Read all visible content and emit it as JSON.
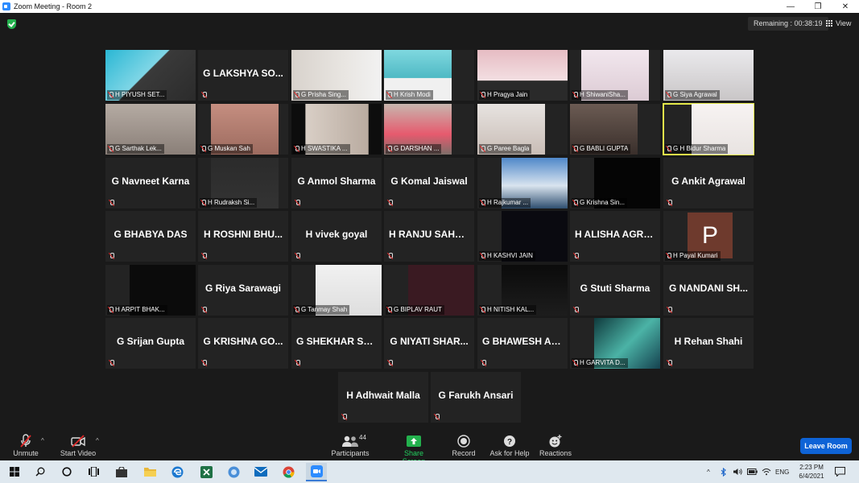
{
  "window": {
    "title": "Zoom Meeting - Room 2",
    "controls": [
      "—",
      "❐",
      "✕"
    ]
  },
  "header": {
    "remaining": "Remaining : 00:38:19",
    "view_label": "View"
  },
  "participants": [
    {
      "name": "H PIYUSH SET...",
      "video": true
    },
    {
      "name": "G LAKSHYA SO...",
      "video": false
    },
    {
      "name": "G Prisha Sing...",
      "video": true
    },
    {
      "name": "H Krish Modi",
      "video": true
    },
    {
      "name": "H Pragya Jain",
      "video": true
    },
    {
      "name": "H ShiwaniSha...",
      "video": true
    },
    {
      "name": "G Siya Agrawal",
      "video": true
    },
    {
      "name": "G Sarthak Lek...",
      "video": true
    },
    {
      "name": "G Muskan Sah",
      "video": true
    },
    {
      "name": "H SWASTIKA ...",
      "video": true
    },
    {
      "name": "G DARSHAN ...",
      "video": true
    },
    {
      "name": "G Paree Bagla",
      "video": true
    },
    {
      "name": "G BABLI GUPTA",
      "video": true
    },
    {
      "name": "G H Bidur Sharma",
      "video": true,
      "speaking": true
    },
    {
      "name": "G Navneet Karna",
      "video": false
    },
    {
      "name": "H Rudraksh Si...",
      "video": true
    },
    {
      "name": "G Anmol Sharma",
      "video": false
    },
    {
      "name": "G Komal Jaiswal",
      "video": false
    },
    {
      "name": "H Rajkumar ...",
      "video": true
    },
    {
      "name": "G Krishna Sin...",
      "video": true
    },
    {
      "name": "G Ankit Agrawal",
      "video": false
    },
    {
      "name": "G BHABYA DAS",
      "video": false
    },
    {
      "name": "H ROSHNI BHU...",
      "video": false
    },
    {
      "name": "H vivek goyal",
      "video": false
    },
    {
      "name": "H RANJU SAHANI",
      "video": false
    },
    {
      "name": "H KASHVI JAIN",
      "video": true
    },
    {
      "name": "H ALISHA AGRA...",
      "video": false
    },
    {
      "name": "H Payal Kumari",
      "video": true,
      "avatar": "P"
    },
    {
      "name": "H ARPIT BHAK...",
      "video": true
    },
    {
      "name": "G Riya Sarawagi",
      "video": false
    },
    {
      "name": "G Tanmay Shah",
      "video": true
    },
    {
      "name": "G BIPLAV RAUT",
      "video": true
    },
    {
      "name": "H NITISH KAL...",
      "video": true
    },
    {
      "name": "G Stuti Sharma",
      "video": false
    },
    {
      "name": "G NANDANI SH...",
      "video": false
    },
    {
      "name": "G Srijan Gupta",
      "video": false
    },
    {
      "name": "G KRISHNA GO...",
      "video": false
    },
    {
      "name": "G SHEKHAR SA...",
      "video": false
    },
    {
      "name": "G NIYATI SHAR...",
      "video": false
    },
    {
      "name": "G BHAWESH AG...",
      "video": false
    },
    {
      "name": "H GARVITA D...",
      "video": true
    },
    {
      "name": "H Rehan Shahi",
      "video": false
    },
    {
      "name": "H Adhwait Malla",
      "video": false
    },
    {
      "name": "G Farukh Ansari",
      "video": false
    }
  ],
  "toolbar": {
    "unmute": "Unmute",
    "start_video": "Start Video",
    "participants": "Participants",
    "participants_count": "44",
    "share_screen": "Share Screen",
    "record": "Record",
    "ask_for_help": "Ask for Help",
    "reactions": "Reactions",
    "leave": "Leave Room"
  },
  "taskbar": {
    "language": "ENG",
    "time": "2:23 PM",
    "date": "6/4/2021"
  },
  "colors": {
    "speaker_outline": "#e4e84a",
    "leave_button": "#0e63d6",
    "share_screen": "#23d160",
    "mic_muted": "#e02828"
  }
}
